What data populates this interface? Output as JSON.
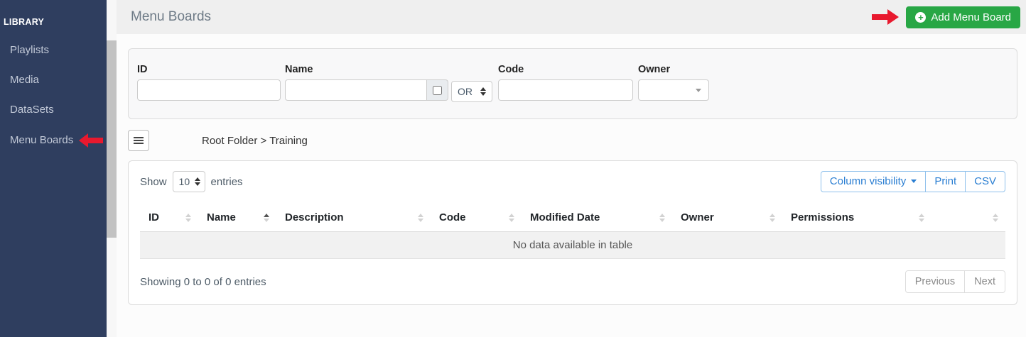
{
  "colors": {
    "sidebar_bg": "#2f3e5f",
    "accent_green": "#28a745",
    "annotation_red": "#e8192e",
    "button_blue": "#2a7ed2"
  },
  "sidebar": {
    "section_label": "LIBRARY",
    "items": [
      {
        "label": "Playlists",
        "active": false
      },
      {
        "label": "Media",
        "active": false
      },
      {
        "label": "DataSets",
        "active": false
      },
      {
        "label": "Menu Boards",
        "active": true,
        "annotated": true
      }
    ]
  },
  "header": {
    "title": "Menu Boards",
    "add_button_label": "Add Menu Board",
    "add_button_icon": "plus-circle"
  },
  "filters": {
    "id_label": "ID",
    "id_value": "",
    "name_label": "Name",
    "name_value": "",
    "name_checkbox_checked": false,
    "operator_value": "OR",
    "code_label": "Code",
    "code_value": "",
    "owner_label": "Owner",
    "owner_value": ""
  },
  "breadcrumb": {
    "text": "Root Folder > Training"
  },
  "table_card": {
    "show_label": "Show",
    "page_length": "10",
    "entries_label": "entries",
    "buttons": [
      {
        "label": "Column visibility",
        "has_caret": true
      },
      {
        "label": "Print",
        "has_caret": false
      },
      {
        "label": "CSV",
        "has_caret": false
      }
    ],
    "columns": [
      {
        "label": "ID",
        "sort": "none"
      },
      {
        "label": "Name",
        "sort": "asc"
      },
      {
        "label": "Description",
        "sort": "none"
      },
      {
        "label": "Code",
        "sort": "none"
      },
      {
        "label": "Modified Date",
        "sort": "none"
      },
      {
        "label": "Owner",
        "sort": "none"
      },
      {
        "label": "Permissions",
        "sort": "none"
      },
      {
        "label": "",
        "sort": "none"
      }
    ],
    "empty_message": "No data available in table",
    "summary": "Showing 0 to 0 of 0 entries",
    "pagination": {
      "previous_label": "Previous",
      "next_label": "Next"
    }
  }
}
